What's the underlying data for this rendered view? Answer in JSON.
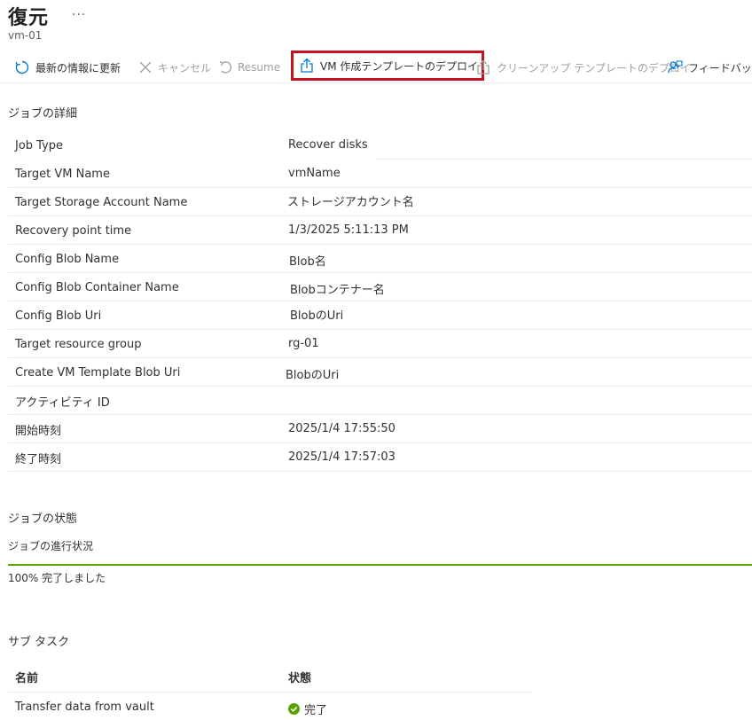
{
  "header": {
    "title": "復元",
    "more": "···",
    "subtitle": "vm-01"
  },
  "toolbar": {
    "refresh": "最新の情報に更新",
    "cancel": "キャンセル",
    "resume": "Resume",
    "deploy_vm_template": "VM 作成テンプレートのデプロイ",
    "deploy_clean_template": "クリーンアップ テンプレートのデプロイ",
    "feedback": "フィードバック"
  },
  "job_details": {
    "section_title": "ジョブの詳細",
    "rows": [
      {
        "key": "Job Type",
        "value": "Recover disks"
      },
      {
        "key": "Target VM Name",
        "value": "vmName"
      },
      {
        "key": "Target Storage Account Name",
        "value": "ストレージアカウント名"
      },
      {
        "key": "Recovery point time",
        "value": "1/3/2025 5:11:13 PM"
      },
      {
        "key": "Config Blob Name",
        "value": "Blob名"
      },
      {
        "key": "Config Blob Container Name",
        "value": "Blobコンテナー名"
      },
      {
        "key": "Config Blob Uri",
        "value": "BlobのUri"
      },
      {
        "key": "Target resource group",
        "value": "rg-01"
      },
      {
        "key": "Create VM Template Blob Uri",
        "value": "BlobのUri"
      },
      {
        "key": "アクティビティ ID",
        "value": ""
      },
      {
        "key": "開始時刻",
        "value": "2025/1/4 17:55:50"
      },
      {
        "key": "終了時刻",
        "value": "2025/1/4 17:57:03"
      }
    ]
  },
  "job_status": {
    "section_title": "ジョブの状態",
    "progress_label": "ジョブの進行状況",
    "progress_percent": 100,
    "progress_text": "100% 完了しました",
    "progress_color": "#57a300"
  },
  "sub_tasks": {
    "section_title": "サブ タスク",
    "columns": [
      "名前",
      "状態"
    ],
    "rows": [
      {
        "name": "Transfer data from vault",
        "status": "完了"
      }
    ],
    "status_color": "#57a300"
  },
  "highlight_color": "#c1121f"
}
